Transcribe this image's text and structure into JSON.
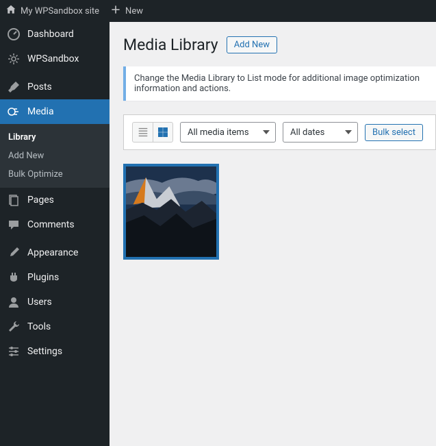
{
  "toolbar": {
    "site_name": "My WPSandbox site",
    "new_label": "New"
  },
  "sidebar": {
    "items": [
      {
        "id": "dashboard",
        "label": "Dashboard",
        "icon": "dashboard"
      },
      {
        "id": "wpsandbox",
        "label": "WPSandbox",
        "icon": "gear"
      },
      {
        "id": "sep"
      },
      {
        "id": "posts",
        "label": "Posts",
        "icon": "pin"
      },
      {
        "id": "media",
        "label": "Media",
        "icon": "media",
        "current": true
      },
      {
        "id": "pages",
        "label": "Pages",
        "icon": "pages"
      },
      {
        "id": "comments",
        "label": "Comments",
        "icon": "comment"
      },
      {
        "id": "sep"
      },
      {
        "id": "appearance",
        "label": "Appearance",
        "icon": "brush"
      },
      {
        "id": "plugins",
        "label": "Plugins",
        "icon": "plug"
      },
      {
        "id": "users",
        "label": "Users",
        "icon": "user"
      },
      {
        "id": "tools",
        "label": "Tools",
        "icon": "wrench"
      },
      {
        "id": "settings",
        "label": "Settings",
        "icon": "sliders"
      }
    ],
    "submenu_media": [
      {
        "label": "Library",
        "current": true
      },
      {
        "label": "Add New"
      },
      {
        "label": "Bulk Optimize"
      }
    ]
  },
  "page": {
    "title": "Media Library",
    "add_new": "Add New",
    "notice": "Change the Media Library to List mode for additional image optimization information and actions.",
    "filter_media": "All media items",
    "filter_dates": "All dates",
    "bulk_select": "Bulk select"
  }
}
